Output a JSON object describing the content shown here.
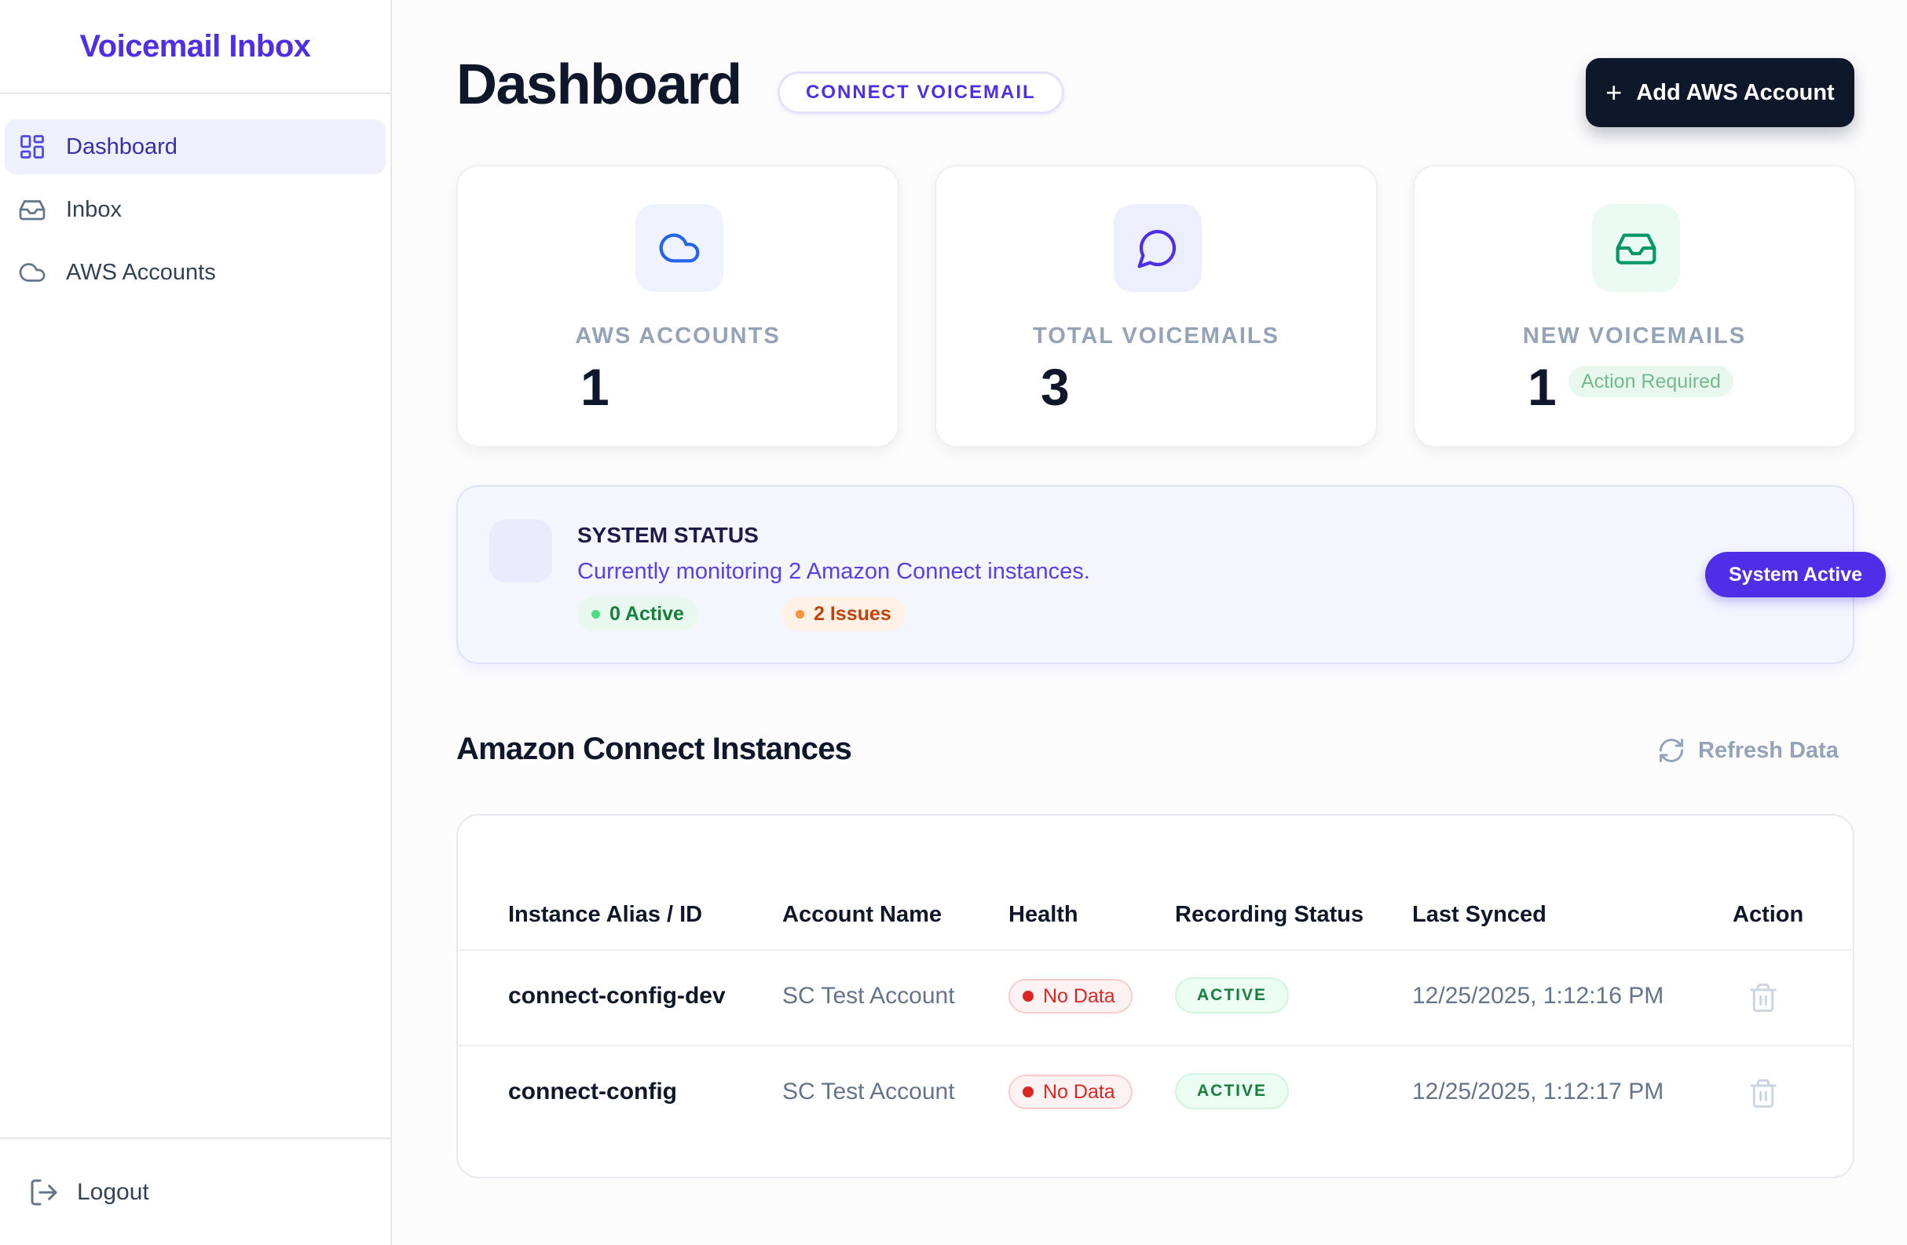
{
  "app": {
    "title": "Voicemail Inbox"
  },
  "sidebar": {
    "items": [
      {
        "label": "Dashboard",
        "icon": "dashboard-grid-icon",
        "active": true
      },
      {
        "label": "Inbox",
        "icon": "inbox-tray-icon",
        "active": false
      },
      {
        "label": "AWS Accounts",
        "icon": "cloud-icon",
        "active": false
      }
    ],
    "logout_label": "Logout"
  },
  "header": {
    "title": "Dashboard",
    "badge": "CONNECT VOICEMAIL",
    "add_button_label": "Add AWS Account"
  },
  "stats": [
    {
      "label": "AWS ACCOUNTS",
      "value": "1",
      "icon": "cloud-icon",
      "accent": "#2563eb"
    },
    {
      "label": "TOTAL VOICEMAILS",
      "value": "3",
      "icon": "chat-bubble-icon",
      "accent": "#4f2ee8"
    },
    {
      "label": "NEW VOICEMAILS",
      "value": "1",
      "icon": "inbox-tray-icon",
      "accent": "#059669",
      "badge": "Action Required"
    }
  ],
  "system_status": {
    "title": "SYSTEM STATUS",
    "message": "Currently monitoring 2 Amazon Connect instances.",
    "active_label": "0 Active",
    "issues_label": "2 Issues",
    "button_label": "System Active"
  },
  "instances": {
    "title": "Amazon Connect Instances",
    "refresh_label": "Refresh Data",
    "columns": [
      "Instance Alias / ID",
      "Account Name",
      "Health",
      "Recording Status",
      "Last Synced",
      "Action"
    ],
    "rows": [
      {
        "alias": "connect-config-dev",
        "account": "SC Test Account",
        "health": "No Data",
        "recording": "ACTIVE",
        "synced": "12/25/2025, 1:12:16 PM"
      },
      {
        "alias": "connect-config",
        "account": "SC Test Account",
        "health": "No Data",
        "recording": "ACTIVE",
        "synced": "12/25/2025, 1:12:17 PM"
      }
    ]
  },
  "colors": {
    "brand": "#4f2ee8",
    "dark": "#0f172a",
    "danger": "#dc2626",
    "success": "#15803d"
  }
}
